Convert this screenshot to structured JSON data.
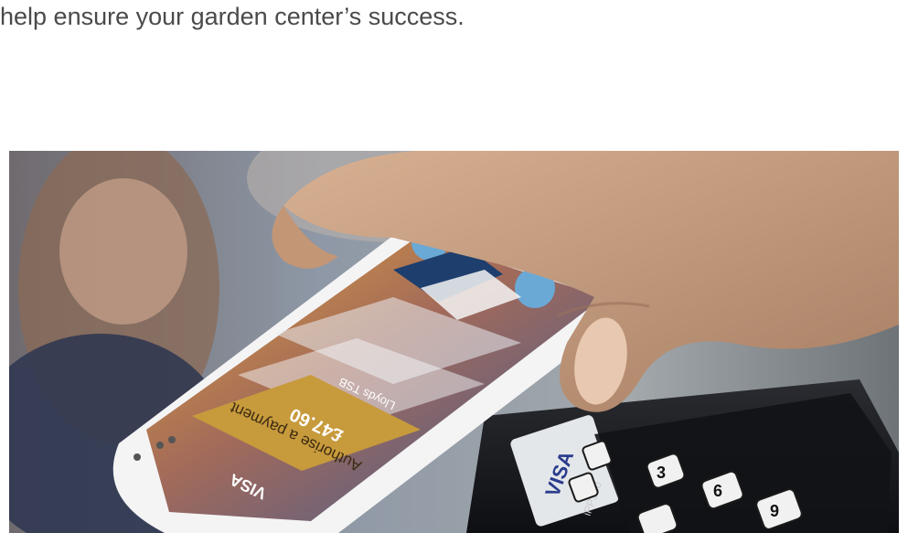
{
  "article": {
    "intro_text": "help ensure your garden center’s success."
  },
  "photo": {
    "image_label": "Smartphone contactless payment at card terminal",
    "phone_app": {
      "merchant": "Lloyds TSB",
      "amount": "£47.60",
      "action": "Authorise a payment",
      "card_brand": "VISA"
    },
    "terminal": {
      "brand": "VISA",
      "model": "iPP350",
      "keys": [
        "3",
        "6",
        "9"
      ]
    },
    "colors": {
      "screen_gold": "#c79a3c",
      "screen_blue": "#3c5c93",
      "terminal_black": "#1b1c1f",
      "skin": "#c9a080"
    }
  }
}
